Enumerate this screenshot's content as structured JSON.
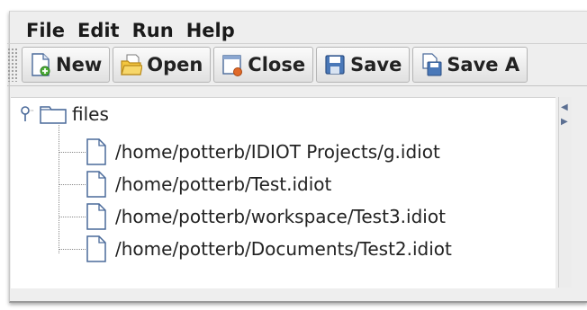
{
  "menubar": {
    "items": [
      "File",
      "Edit",
      "Run",
      "Help"
    ]
  },
  "toolbar": {
    "buttons": [
      {
        "label": "New",
        "icon": "new-document-icon"
      },
      {
        "label": "Open",
        "icon": "open-folder-icon"
      },
      {
        "label": "Close",
        "icon": "close-document-icon"
      },
      {
        "label": "Save",
        "icon": "floppy-disk-icon"
      },
      {
        "label": "Save A",
        "icon": "save-as-icon"
      }
    ]
  },
  "tree": {
    "root_label": "files",
    "files": [
      "/home/potterb/IDIOT Projects/g.idiot",
      "/home/potterb/Test.idiot",
      "/home/potterb/workspace/Test3.idiot",
      "/home/potterb/Documents/Test2.idiot"
    ]
  }
}
